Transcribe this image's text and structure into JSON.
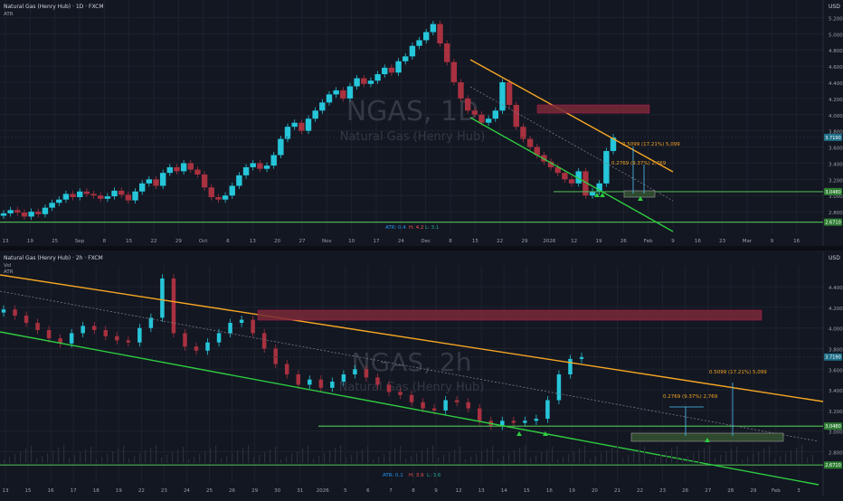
{
  "colors": {
    "background": "#131722",
    "grid": "#1e222d",
    "up": "#26c6da",
    "down": "#a93140",
    "trend_orange": "#f5a623",
    "channel_green": "#2ecc40",
    "support_green": "#4caf50",
    "resistance_zone": "#7a2a36",
    "support_zone": "#2f4a2f",
    "watermark": "#3a3e4a",
    "target_line": "#4fc3f7",
    "axis_text": "#9aa0ab"
  },
  "chart_data": [
    {
      "type": "candlestick",
      "title": "Natural Gas (Henry Hub) · 1D · FXCM",
      "indicator_label": "ATR",
      "currency": "USD",
      "watermark": "NGAS, 1D",
      "watermark_sub": "Natural Gas (Henry Hub)",
      "y_ticks": [
        "5.200",
        "5.000",
        "4.800",
        "4.600",
        "4.400",
        "4.200",
        "4.000",
        "3.800",
        "3.600",
        "3.400",
        "3.200",
        "3.000",
        "2.800"
      ],
      "x_ticks": [
        "13",
        "19",
        "25",
        "Sep",
        "8",
        "15",
        "22",
        "29",
        "Oct",
        "6",
        "13",
        "20",
        "27",
        "Nov",
        "10",
        "17",
        "24",
        "Dec",
        "8",
        "15",
        "22",
        "29",
        "2026",
        "12",
        "19",
        "26",
        "Feb",
        "9",
        "16",
        "23",
        "Mar",
        "9",
        "16"
      ],
      "ylim": [
        2.6,
        5.35
      ],
      "price_badges": [
        {
          "value": 3.719,
          "label": "3.7190",
          "kind": "current"
        },
        {
          "value": 3.048,
          "label": "3.0480",
          "kind": "support"
        },
        {
          "value": 2.671,
          "label": "2.6710",
          "kind": "support"
        }
      ],
      "atr_readout": {
        "atr": "ATR: 0.4",
        "h": "H: 4.2",
        "l": "L: 3.1"
      },
      "annotations": [
        {
          "text": "0.5099 (17.21%) 5,099"
        },
        {
          "text": "0.2769 (9.37%) 2,769"
        }
      ],
      "closes": [
        2.78,
        2.82,
        2.79,
        2.74,
        2.8,
        2.77,
        2.85,
        2.91,
        2.95,
        3.02,
        2.98,
        3.05,
        3.02,
        3.0,
        2.96,
        2.99,
        3.06,
        3.01,
        2.94,
        3.05,
        3.15,
        3.2,
        3.12,
        3.28,
        3.35,
        3.3,
        3.4,
        3.32,
        3.26,
        3.1,
        2.98,
        2.95,
        3.0,
        3.12,
        3.25,
        3.35,
        3.4,
        3.33,
        3.37,
        3.5,
        3.7,
        3.85,
        3.9,
        3.8,
        3.95,
        4.05,
        4.15,
        4.25,
        4.3,
        4.2,
        4.35,
        4.45,
        4.38,
        4.42,
        4.5,
        4.58,
        4.52,
        4.66,
        4.72,
        4.85,
        4.92,
        5.02,
        5.12,
        4.88,
        4.65,
        4.4,
        4.2,
        4.05,
        4.0,
        3.9,
        3.95,
        4.05,
        4.4,
        4.12,
        3.85,
        3.7,
        3.6,
        3.5,
        3.42,
        3.35,
        3.28,
        3.2,
        3.15,
        3.3,
        3.0,
        3.05,
        3.15,
        3.55,
        3.72
      ]
    },
    {
      "type": "candlestick",
      "title": "Natural Gas (Henry Hub) · 2h · FXCM",
      "indicator_labels": [
        "Vol",
        "ATR"
      ],
      "currency": "USD",
      "watermark": "NGAS, 2h",
      "watermark_sub": "Natural Gas (Henry Hub)",
      "y_ticks": [
        "4.400",
        "4.200",
        "4.000",
        "3.800",
        "3.600",
        "3.400",
        "3.200",
        "3.000",
        "2.800"
      ],
      "x_ticks": [
        "13",
        "15",
        "16",
        "17",
        "18",
        "19",
        "22",
        "23",
        "24",
        "25",
        "26",
        "29",
        "30",
        "31",
        "2026",
        "5",
        "6",
        "7",
        "8",
        "9",
        "12",
        "13",
        "14",
        "15",
        "16",
        "19",
        "20",
        "21",
        "22",
        "23",
        "26",
        "27",
        "28",
        "29",
        "Feb",
        "3"
      ],
      "ylim": [
        2.55,
        4.55
      ],
      "price_badges": [
        {
          "value": 3.719,
          "label": "3.7190",
          "kind": "current"
        },
        {
          "value": 3.048,
          "label": "3.0480",
          "kind": "support"
        },
        {
          "value": 2.671,
          "label": "2.6710",
          "kind": "support"
        }
      ],
      "atr_readout": {
        "atr": "ATR: 0.1",
        "h": "H: 3.9",
        "l": "L: 3.6"
      },
      "annotations": [
        {
          "text": "0.5099 (17.21%) 5,099"
        },
        {
          "text": "0.2769 (9.37%) 2,769"
        }
      ],
      "closes": [
        4.18,
        4.12,
        4.05,
        3.98,
        3.9,
        3.85,
        3.95,
        4.02,
        3.98,
        3.92,
        3.88,
        3.86,
        4.0,
        4.1,
        4.48,
        3.95,
        3.82,
        3.78,
        3.86,
        3.95,
        4.05,
        4.08,
        3.95,
        3.8,
        3.65,
        3.55,
        3.45,
        3.5,
        3.42,
        3.48,
        3.55,
        3.6,
        3.52,
        3.45,
        3.38,
        3.35,
        3.28,
        3.22,
        3.2,
        3.3,
        3.28,
        3.22,
        3.1,
        3.05,
        3.1,
        3.08,
        3.1,
        3.12,
        3.3,
        3.55,
        3.7,
        3.72
      ]
    }
  ]
}
